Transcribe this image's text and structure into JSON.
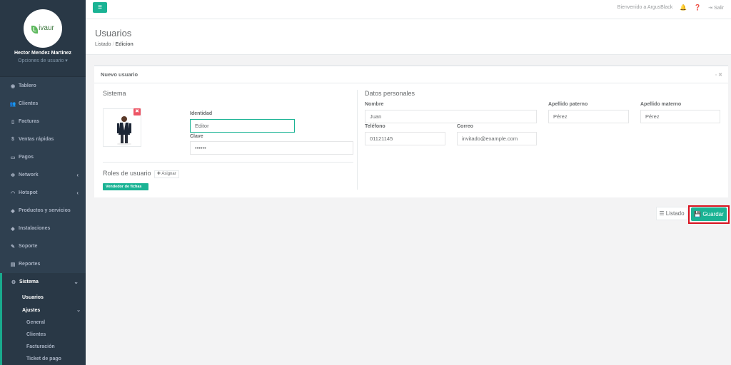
{
  "brand": {
    "logo_letter": "L",
    "logo_text": "ivaur"
  },
  "profile": {
    "name": "Hector Mendez Martinez",
    "options": "Opciones de usuario ▾"
  },
  "menu": [
    {
      "icon": "dashboard-icon",
      "glyph": "◉",
      "label": "Tablero",
      "chevron": ""
    },
    {
      "icon": "users-icon",
      "glyph": "👥",
      "label": "Clientes",
      "chevron": ""
    },
    {
      "icon": "file-icon",
      "glyph": "▯",
      "label": "Facturas",
      "chevron": ""
    },
    {
      "icon": "dollar-icon",
      "glyph": "$",
      "label": "Ventas rápidas",
      "chevron": ""
    },
    {
      "icon": "money-icon",
      "glyph": "▭",
      "label": "Pagos",
      "chevron": ""
    },
    {
      "icon": "network-icon",
      "glyph": "✻",
      "label": "Network",
      "chevron": "‹"
    },
    {
      "icon": "wifi-icon",
      "glyph": "◠",
      "label": "Hotspot",
      "chevron": "‹"
    },
    {
      "icon": "tag-icon",
      "glyph": "◆",
      "label": "Productos y servicios",
      "chevron": ""
    },
    {
      "icon": "tag-icon",
      "glyph": "◆",
      "label": "Instalaciones",
      "chevron": ""
    },
    {
      "icon": "wrench-icon",
      "glyph": "✎",
      "label": "Soporte",
      "chevron": ""
    },
    {
      "icon": "book-icon",
      "glyph": "▤",
      "label": "Reportes",
      "chevron": ""
    }
  ],
  "sistema": {
    "label": "Sistema",
    "glyph": "⚙",
    "chevron": "⌄",
    "usuarios": "Usuarios",
    "ajustes": "Ajustes",
    "ajustes_chevron": "⌄",
    "ajustes_items": [
      "General",
      "Clientes",
      "Facturación",
      "Ticket de pago"
    ]
  },
  "topbar": {
    "menu_glyph": "≡",
    "welcome": "Bienvenido a ArgusBlack",
    "bell": "🔔",
    "help": "❓",
    "logout_glyph": "⇥",
    "logout": "Salir"
  },
  "page": {
    "title": "Usuarios",
    "breadcrumb_1": "Listado",
    "breadcrumb_sep": "/",
    "breadcrumb_2": "Edicion"
  },
  "panel": {
    "title": "Nuevo usuario",
    "tools": "▫ ✖",
    "system_title": "Sistema",
    "photo_remove": "✖",
    "identity_label": "Identidad",
    "identity_value": "Editor",
    "password_label": "Clave",
    "password_value": "••••••",
    "roles_title": "Roles de usuario",
    "assign_button": "✚ Asignar",
    "role_badge": "Vendedor de fichas",
    "personal_title": "Datos personales",
    "nombre_label": "Nombre",
    "nombre_value": "Juan",
    "paterno_label": "Apellido paterno",
    "paterno_value": "Pérez",
    "materno_label": "Apellido materno",
    "materno_value": "Pérez",
    "telefono_label": "Teléfono",
    "telefono_value": "01121145",
    "correo_label": "Correo",
    "correo_value": "invitado@example.com"
  },
  "actions": {
    "listado": "☰ Listado",
    "guardar": "💾 Guardar"
  },
  "colors": {
    "accent": "#1ab394",
    "sidebar": "#2f4050",
    "danger": "#ed5565",
    "highlight": "#d9121f"
  }
}
